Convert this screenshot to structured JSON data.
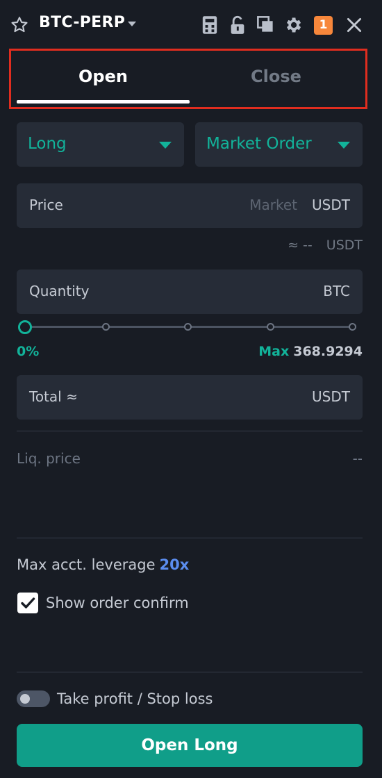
{
  "header": {
    "pair": "BTC-PERP",
    "notification_count": "1",
    "icons": [
      "star-icon",
      "calculator-icon",
      "unlock-icon",
      "copy-icon",
      "gear-icon",
      "close-icon"
    ]
  },
  "tabs": [
    {
      "label": "Open",
      "active": true
    },
    {
      "label": "Close",
      "active": false
    }
  ],
  "order": {
    "side": "Long",
    "type": "Market Order"
  },
  "price": {
    "label": "Price",
    "placeholder": "Market",
    "unit": "USDT",
    "approx": "≈ --",
    "approx_unit": "USDT"
  },
  "quantity": {
    "label": "Quantity",
    "unit": "BTC",
    "slider_percent": "0%",
    "slider_value": 0,
    "max_label": "Max",
    "max_value": "368.9294"
  },
  "total": {
    "label": "Total ≈",
    "unit": "USDT"
  },
  "liq": {
    "label": "Liq. price",
    "value": "--"
  },
  "leverage": {
    "label": "Max acct. leverage",
    "value": "20x"
  },
  "confirm": {
    "label": "Show order confirm",
    "checked": true
  },
  "tpsl": {
    "label": "Take profit / Stop loss",
    "enabled": false
  },
  "submit": {
    "label": "Open Long"
  },
  "colors": {
    "accent": "#12b39a",
    "button": "#109e89",
    "leverage": "#5b8def",
    "badge": "#f7873b",
    "highlight_border": "#e02d1f",
    "background": "#181c24",
    "panel": "#262c37"
  }
}
